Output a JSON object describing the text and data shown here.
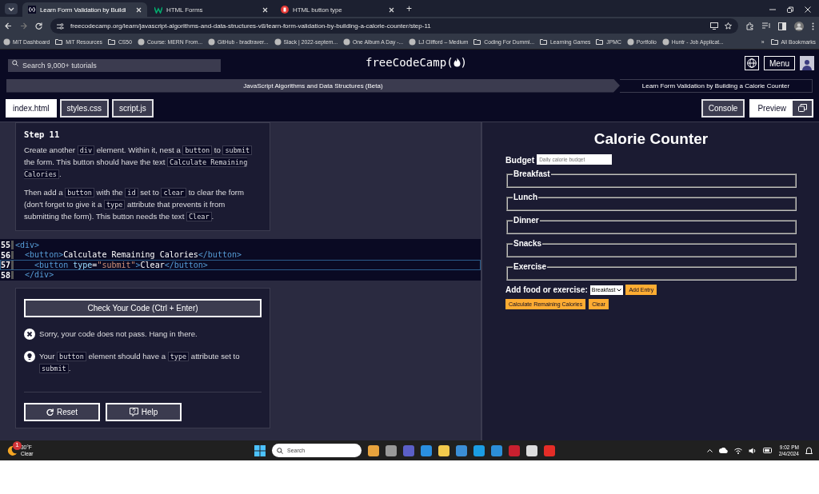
{
  "browser": {
    "tabs": [
      {
        "title": "Learn Form Validation by Buildi",
        "selected": true
      },
      {
        "title": "HTML Forms",
        "selected": false
      },
      {
        "title": "HTML button type",
        "selected": false
      }
    ],
    "new_tab": "+",
    "url": "freecodecamp.org/learn/javascript-algorithms-and-data-structures-v8/learn-form-validation-by-building-a-calorie-counter/step-11",
    "bookmarks": [
      {
        "label": "MiT Dashboard",
        "kind": "site"
      },
      {
        "label": "MiT Resources",
        "kind": "folder"
      },
      {
        "label": "CS50",
        "kind": "folder"
      },
      {
        "label": "Course: MERN From...",
        "kind": "site"
      },
      {
        "label": "GitHub - bradtraver...",
        "kind": "site"
      },
      {
        "label": "Slack | 2022-septem...",
        "kind": "site"
      },
      {
        "label": "One Album A Day -...",
        "kind": "site"
      },
      {
        "label": "LJ Clifford – Medium",
        "kind": "site"
      },
      {
        "label": "Coding For Dummi...",
        "kind": "folder"
      },
      {
        "label": "Learning Games",
        "kind": "folder"
      },
      {
        "label": "JPMC",
        "kind": "folder"
      },
      {
        "label": "Portfolio",
        "kind": "site"
      },
      {
        "label": "Huntr - Job Applicat...",
        "kind": "site"
      }
    ],
    "bookmarks_overflow": "»",
    "all_bookmarks": "All Bookmarks"
  },
  "header": {
    "search": {
      "placeholder": "Search 9,000+ tutorials"
    },
    "logo": [
      "freeCodeCamp(",
      ")"
    ],
    "menu": "Menu"
  },
  "breadcrumbs": [
    {
      "label": "JavaScript Algorithms and Data Structures (Beta)"
    },
    {
      "label": "Learn Form Validation by Building a Calorie Counter"
    }
  ],
  "file_tabs": [
    {
      "label": "index.html",
      "selected": true
    },
    {
      "label": "styles.css",
      "selected": false
    },
    {
      "label": "script.js",
      "selected": false
    }
  ],
  "console": "Console",
  "preview": "Preview",
  "instructions": {
    "title": "Step 11",
    "paragraphs": [
      [
        {
          "text": "Create another ",
          "kind": "text"
        },
        {
          "text": "div",
          "kind": "code"
        },
        {
          "text": " element. Within it, nest a ",
          "kind": "text"
        },
        {
          "text": "button",
          "kind": "code"
        },
        {
          "text": " to ",
          "kind": "text"
        },
        {
          "text": "submit",
          "kind": "code"
        },
        {
          "text": " the form. This button should have the text ",
          "kind": "text"
        },
        {
          "text": "Calculate Remaining Calories",
          "kind": "code"
        },
        {
          "text": ".",
          "kind": "text"
        }
      ],
      [
        {
          "text": "Then add a ",
          "kind": "text"
        },
        {
          "text": "button",
          "kind": "code"
        },
        {
          "text": " with the ",
          "kind": "text"
        },
        {
          "text": "id",
          "kind": "code"
        },
        {
          "text": " set to ",
          "kind": "text"
        },
        {
          "text": "clear",
          "kind": "code"
        },
        {
          "text": " to clear the form (don't forget to give it a ",
          "kind": "text"
        },
        {
          "text": "type",
          "kind": "code"
        },
        {
          "text": " attribute that prevents it from submitting the form). This button needs the text ",
          "kind": "text"
        },
        {
          "text": "Clear",
          "kind": "code"
        },
        {
          "text": ".",
          "kind": "text"
        }
      ]
    ]
  },
  "editor": {
    "lines": [
      {
        "number": "55",
        "selected": false,
        "tokens": [
          {
            "text": "<div>",
            "kind": "tag"
          }
        ]
      },
      {
        "number": "56",
        "selected": false,
        "tokens": [
          {
            "text": "  <button>",
            "kind": "tag"
          },
          {
            "text": "Calculate Remaining Calories",
            "kind": "text"
          },
          {
            "text": "</button>",
            "kind": "tag"
          }
        ]
      },
      {
        "number": "57",
        "selected": true,
        "tokens": [
          {
            "text": "    <button ",
            "kind": "tag"
          },
          {
            "text": "type",
            "kind": "attr"
          },
          {
            "text": "=",
            "kind": "text"
          },
          {
            "text": "\"submit\"",
            "kind": "string"
          },
          {
            "text": ">",
            "kind": "tag"
          },
          {
            "text": "Clear",
            "kind": "text"
          },
          {
            "text": "</button>",
            "kind": "tag"
          }
        ]
      },
      {
        "number": "58",
        "selected": false,
        "tokens": [
          {
            "text": "  </div>",
            "kind": "tag"
          }
        ]
      }
    ]
  },
  "check_button": "Check Your Code (Ctrl + Enter)",
  "feedback": [
    {
      "kind": "error",
      "segments": [
        {
          "text": "Sorry, your code does not pass. Hang in there.",
          "kind": "text"
        }
      ]
    },
    {
      "kind": "hint",
      "segments": [
        {
          "text": "Your ",
          "kind": "text"
        },
        {
          "text": "button",
          "kind": "code"
        },
        {
          "text": " element should have a ",
          "kind": "text"
        },
        {
          "text": "type",
          "kind": "code"
        },
        {
          "text": " attribute set to ",
          "kind": "text"
        },
        {
          "text": "submit",
          "kind": "code"
        },
        {
          "text": ".",
          "kind": "text"
        }
      ]
    }
  ],
  "reset": "Reset",
  "help": "Help",
  "preview_page": {
    "title": "Calorie Counter",
    "budget_label": "Budget",
    "budget_placeholder": "Daily calorie budget",
    "fieldsets": [
      "Breakfast",
      "Lunch",
      "Dinner",
      "Snacks",
      "Exercise"
    ],
    "add_label": "Add food or exercise:",
    "select_value": "Breakfast",
    "add_entry": "Add Entry",
    "buttons": [
      "Calculate Remaining Calories",
      "Clear"
    ]
  },
  "taskbar": {
    "weather_temp": "30°F",
    "weather_text": "Clear",
    "weather_badge": "1",
    "search_placeholder": "Search",
    "time": "9:02 PM",
    "date": "2/4/2024"
  }
}
